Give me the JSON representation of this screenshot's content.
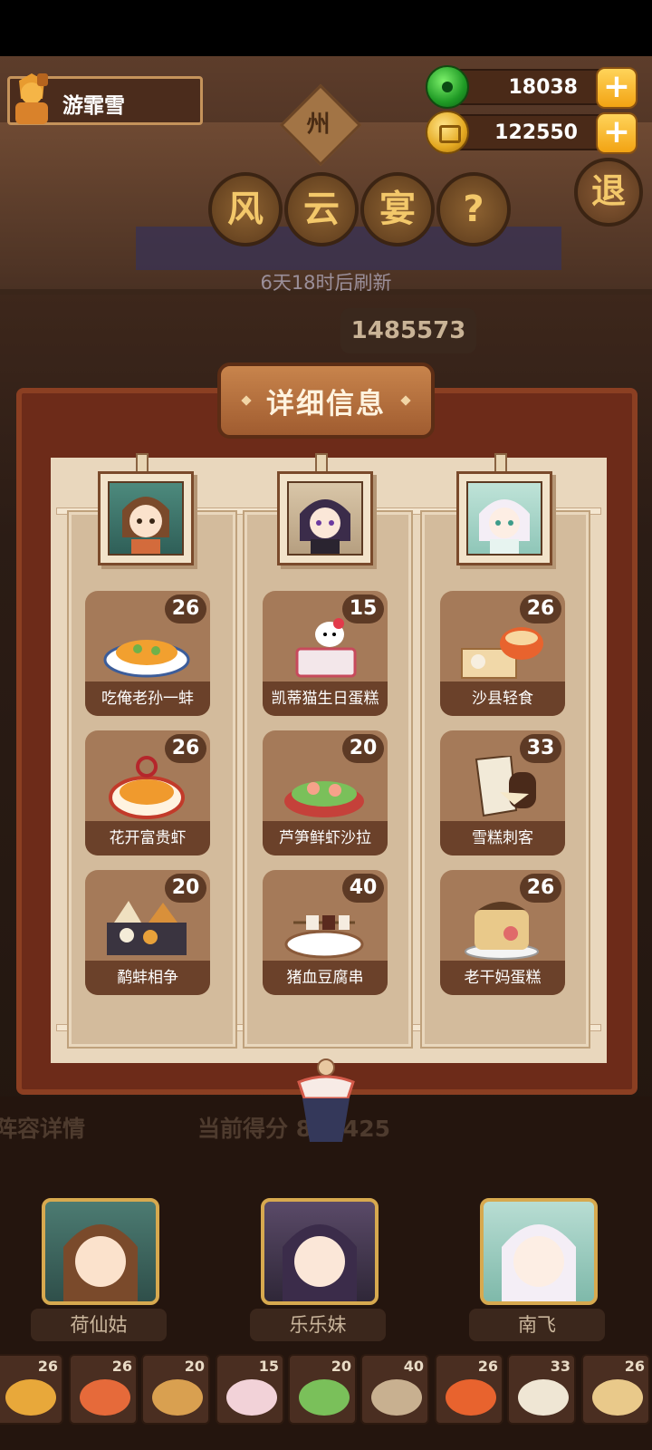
{
  "player": {
    "name": "游霏雪"
  },
  "currency": {
    "jade": "18038",
    "coins": "122550"
  },
  "location_sign": "州",
  "title_chars": [
    "风",
    "云",
    "宴"
  ],
  "help_symbol": "?",
  "exit_label": "退",
  "refresh_text": "6天18时后刷新",
  "top_score": "1485573",
  "panel": {
    "title": "详细信息",
    "columns": [
      {
        "dishes": [
          {
            "name": "吃俺老孙一蚌",
            "count": "26"
          },
          {
            "name": "花开富贵虾",
            "count": "26"
          },
          {
            "name": "鹬蚌相争",
            "count": "20"
          }
        ]
      },
      {
        "dishes": [
          {
            "name": "凯蒂猫生日蛋糕",
            "count": "15"
          },
          {
            "name": "芦笋鲜虾沙拉",
            "count": "20"
          },
          {
            "name": "猪血豆腐串",
            "count": "40"
          }
        ]
      },
      {
        "dishes": [
          {
            "name": "沙县轻食",
            "count": "26"
          },
          {
            "name": "雪糕刺客",
            "count": "33"
          },
          {
            "name": "老干妈蛋糕",
            "count": "26"
          }
        ]
      }
    ]
  },
  "behind": {
    "left_partial": "阵容详情",
    "score_partial": "当前得分 868425"
  },
  "team": [
    "荷仙姑",
    "乐乐妹",
    "南飞"
  ],
  "dish_strip": [
    "26",
    "26",
    "20",
    "15",
    "20",
    "40",
    "26",
    "33",
    "26"
  ]
}
